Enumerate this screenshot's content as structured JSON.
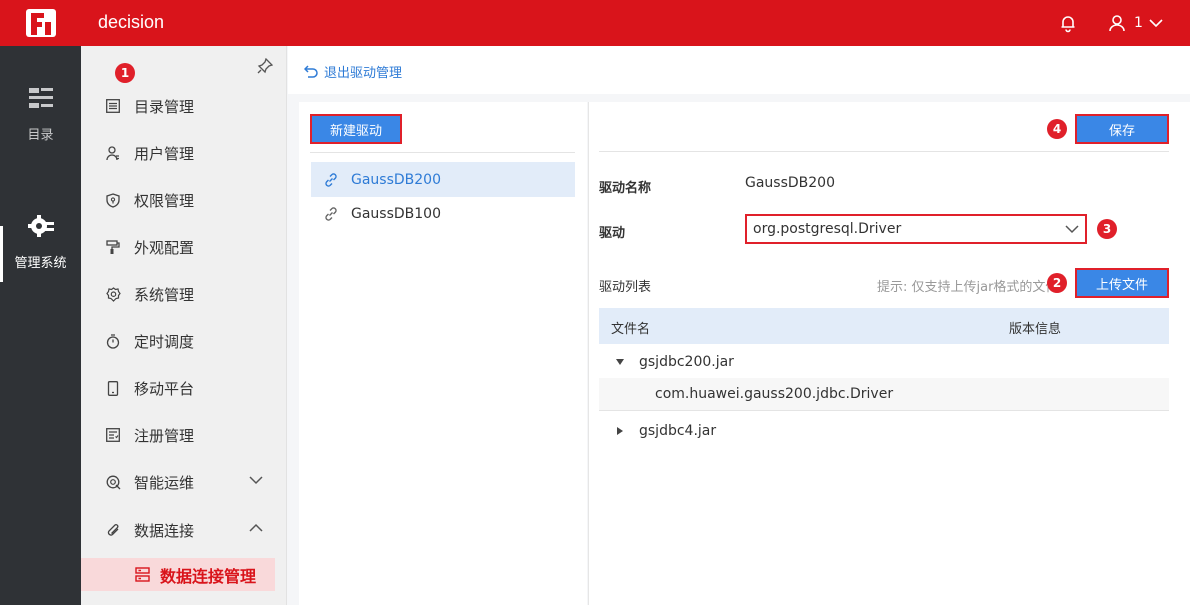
{
  "header": {
    "app_title": "decision",
    "user_label": "1",
    "brand_color": "#d9141b"
  },
  "rail": {
    "items": [
      {
        "label": "目录",
        "icon": "catalog-icon"
      },
      {
        "label": "管理系统",
        "icon": "gear-icon"
      }
    ]
  },
  "menu": {
    "items": [
      {
        "label": "目录管理",
        "icon": "list-icon"
      },
      {
        "label": "用户管理",
        "icon": "user-icon"
      },
      {
        "label": "权限管理",
        "icon": "shield-icon"
      },
      {
        "label": "外观配置",
        "icon": "paint-roller-icon"
      },
      {
        "label": "系统管理",
        "icon": "settings-icon"
      },
      {
        "label": "定时调度",
        "icon": "timer-icon"
      },
      {
        "label": "移动平台",
        "icon": "phone-icon"
      },
      {
        "label": "注册管理",
        "icon": "register-icon"
      },
      {
        "label": "智能运维",
        "icon": "ops-icon"
      },
      {
        "label": "数据连接",
        "icon": "paperclip-icon"
      }
    ],
    "active_sub": {
      "label": "数据连接管理",
      "icon": "database-icon"
    }
  },
  "content": {
    "back_label": "退出驱动管理",
    "new_driver_label": "新建驱动",
    "drivers": [
      "GaussDB200",
      "GaussDB100"
    ],
    "active_driver": "GaussDB200",
    "save_label": "保存",
    "name_label": "驱动名称",
    "name_value": "GaussDB200",
    "driver_label": "驱动",
    "driver_value": "org.postgresql.Driver",
    "list_label": "驱动列表",
    "hint": "提示: 仅支持上传jar格式的文件",
    "upload_label": "上传文件",
    "table": {
      "headers": [
        "文件名",
        "版本信息"
      ],
      "rows": [
        {
          "name": "gsjdbc200.jar",
          "expanded": true,
          "children": [
            "com.huawei.gauss200.jdbc.Driver"
          ]
        },
        {
          "name": "gsjdbc4.jar",
          "expanded": false,
          "children": []
        }
      ]
    },
    "badges": [
      "1",
      "2",
      "3",
      "4"
    ]
  }
}
